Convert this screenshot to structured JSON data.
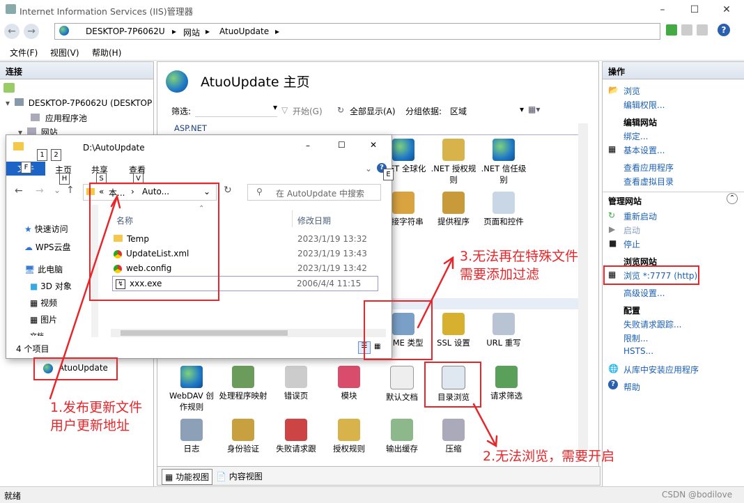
{
  "window": {
    "title": "Internet Information Services (IIS)管理器"
  },
  "address": {
    "crumbs": [
      "DESKTOP-7P6062U",
      "网站",
      "AtuoUpdate"
    ]
  },
  "menu": [
    "文件(F)",
    "视图(V)",
    "帮助(H)"
  ],
  "connections": {
    "title": "连接",
    "tree": {
      "server": "DESKTOP-7P6062U (DESKTOP",
      "app_pools": "应用程序池",
      "sites": "网站",
      "site": "AtuoUpdate"
    }
  },
  "center": {
    "title": "AtuoUpdate 主页",
    "filter_label": "筛选:",
    "start_label": "开始(G)",
    "show_all_label": "全部显示(A)",
    "group_by_label": "分组依据:",
    "group_by_value": "区域",
    "group_aspnet": "ASP.NET",
    "features_row1": [
      ".NET 全球化",
      ".NET 授权规则",
      ".NET 信任级别"
    ],
    "features_row2": [
      "连接字符串",
      "提供程序",
      "页面和控件"
    ],
    "features_row3": [
      "MIME 类型",
      "SSL 设置",
      "URL 重写"
    ],
    "features_row4": [
      "WebDAV 创作规则",
      "处理程序映射",
      "错误页",
      "模块",
      "默认文档",
      "目录浏览",
      "请求筛选"
    ],
    "features_row5": [
      "日志",
      "身份验证",
      "失败请求跟",
      "授权规则",
      "输出缓存",
      "压缩"
    ],
    "bottom_tabs": [
      "功能视图",
      "内容视图"
    ]
  },
  "actions": {
    "title": "操作",
    "items": [
      "浏览",
      "编辑权限..."
    ],
    "edit_site_head": "编辑网站",
    "edit_site": [
      "绑定...",
      "基本设置..."
    ],
    "view_app": "查看应用程序",
    "view_vdir": "查看虚拟目录",
    "manage_head": "管理网站",
    "restart": "重新启动",
    "start": "启动",
    "stop": "停止",
    "browse_head": "浏览网站",
    "browse_link": "浏览 *:7777 (http)",
    "advanced": "高级设置...",
    "config_head": "配置",
    "failed_trace": "失败请求跟踪...",
    "limits": "限制...",
    "hsts": "HSTS...",
    "install_gallery": "从库中安装应用程序",
    "help": "帮助"
  },
  "status": "就绪",
  "explorer": {
    "path": "D:\\AutoUpdate",
    "ribbon_tabs": [
      "文件",
      "主页",
      "共享",
      "查看"
    ],
    "keytips": [
      "1",
      "2",
      "F",
      "H",
      "S",
      "V",
      "E"
    ],
    "breadcrumb": [
      "本...",
      "Auto..."
    ],
    "search_placeholder": "在 AutoUpdate 中搜索",
    "nav": [
      "快速访问",
      "WPS云盘",
      "此电脑",
      "3D 对象",
      "视频",
      "图片",
      "文档"
    ],
    "col_name": "名称",
    "col_date": "修改日期",
    "files": [
      {
        "name": "Temp",
        "date": "2023/1/19 13:32"
      },
      {
        "name": "UpdateList.xml",
        "date": "2023/1/19 13:43"
      },
      {
        "name": "web.config",
        "date": "2023/1/19 13:42"
      },
      {
        "name": "xxx.exe",
        "date": "2006/4/4 11:15"
      }
    ],
    "count": "4 个项目"
  },
  "annotations": {
    "a1_line1": "1.发布更新文件",
    "a1_line2": "用户更新地址",
    "a2": "2.无法浏览，需要开启",
    "a3_line1": "3.无法再在特殊文件",
    "a3_line2": "需要添加过滤"
  },
  "watermark": "CSDN @bodilove"
}
